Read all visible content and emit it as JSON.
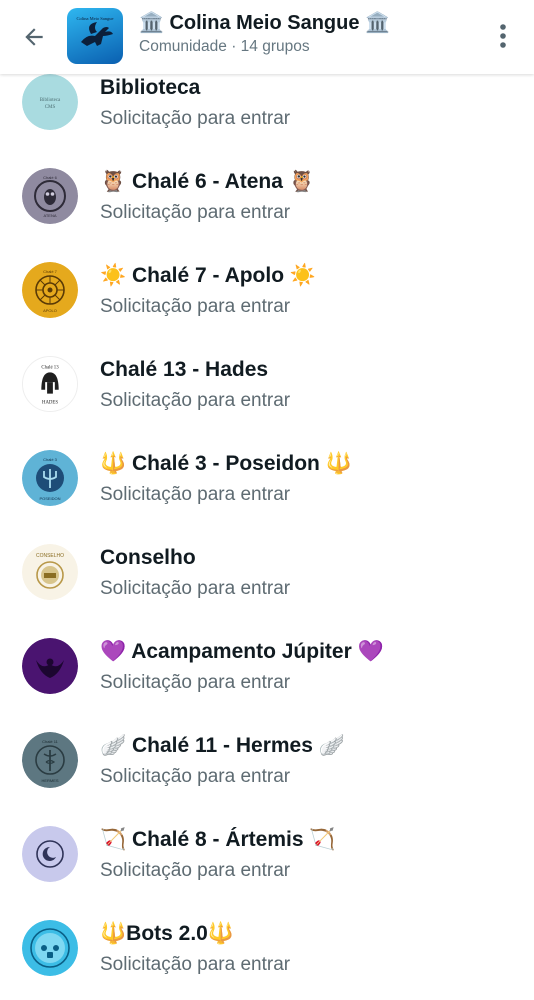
{
  "header": {
    "title": "🏛️ Colina Meio Sangue 🏛️",
    "subtitle": "Comunidade · 14 grupos",
    "avatar_text": "Colina Meio Sangue"
  },
  "groups": [
    {
      "name": "Biblioteca",
      "status": "Solicitação para entrar",
      "avatar_text": "Biblioteca CMS",
      "avatar_color": "#a9dbe0"
    },
    {
      "name": "🦉 Chalé 6 - Atena 🦉",
      "status": "Solicitação para entrar",
      "avatar_text": "Chalé 6",
      "avatar_color": "#8f8aa0"
    },
    {
      "name": "☀️ Chalé 7 - Apolo ☀️",
      "status": "Solicitação para entrar",
      "avatar_text": "Chalé 7",
      "avatar_color": "#e5a91d"
    },
    {
      "name": "Chalé 13 - Hades",
      "status": "Solicitação para entrar",
      "avatar_text": "Chalé 13",
      "avatar_color": "#ffffff"
    },
    {
      "name": "🔱 Chalé 3 - Poseidon 🔱",
      "status": "Solicitação para entrar",
      "avatar_text": "Chalé 3",
      "avatar_color": "#5fb3d6"
    },
    {
      "name": "Conselho",
      "status": "Solicitação para entrar",
      "avatar_text": "CONSELHO",
      "avatar_color": "#f8f3e6"
    },
    {
      "name": "💜 Acampamento Júpiter 💜",
      "status": "Solicitação para entrar",
      "avatar_text": "",
      "avatar_color": "#4a1470"
    },
    {
      "name": "🪽 Chalé 11 - Hermes 🪽",
      "status": "Solicitação para entrar",
      "avatar_text": "Chalé 11",
      "avatar_color": "#5d7781"
    },
    {
      "name": "🏹 Chalé 8 - Ártemis 🏹",
      "status": "Solicitação para entrar",
      "avatar_text": "",
      "avatar_color": "#c8c9ec"
    },
    {
      "name": "🔱Bots 2.0🔱",
      "status": "Solicitação para entrar",
      "avatar_text": "",
      "avatar_color": "#3cbde6"
    }
  ]
}
